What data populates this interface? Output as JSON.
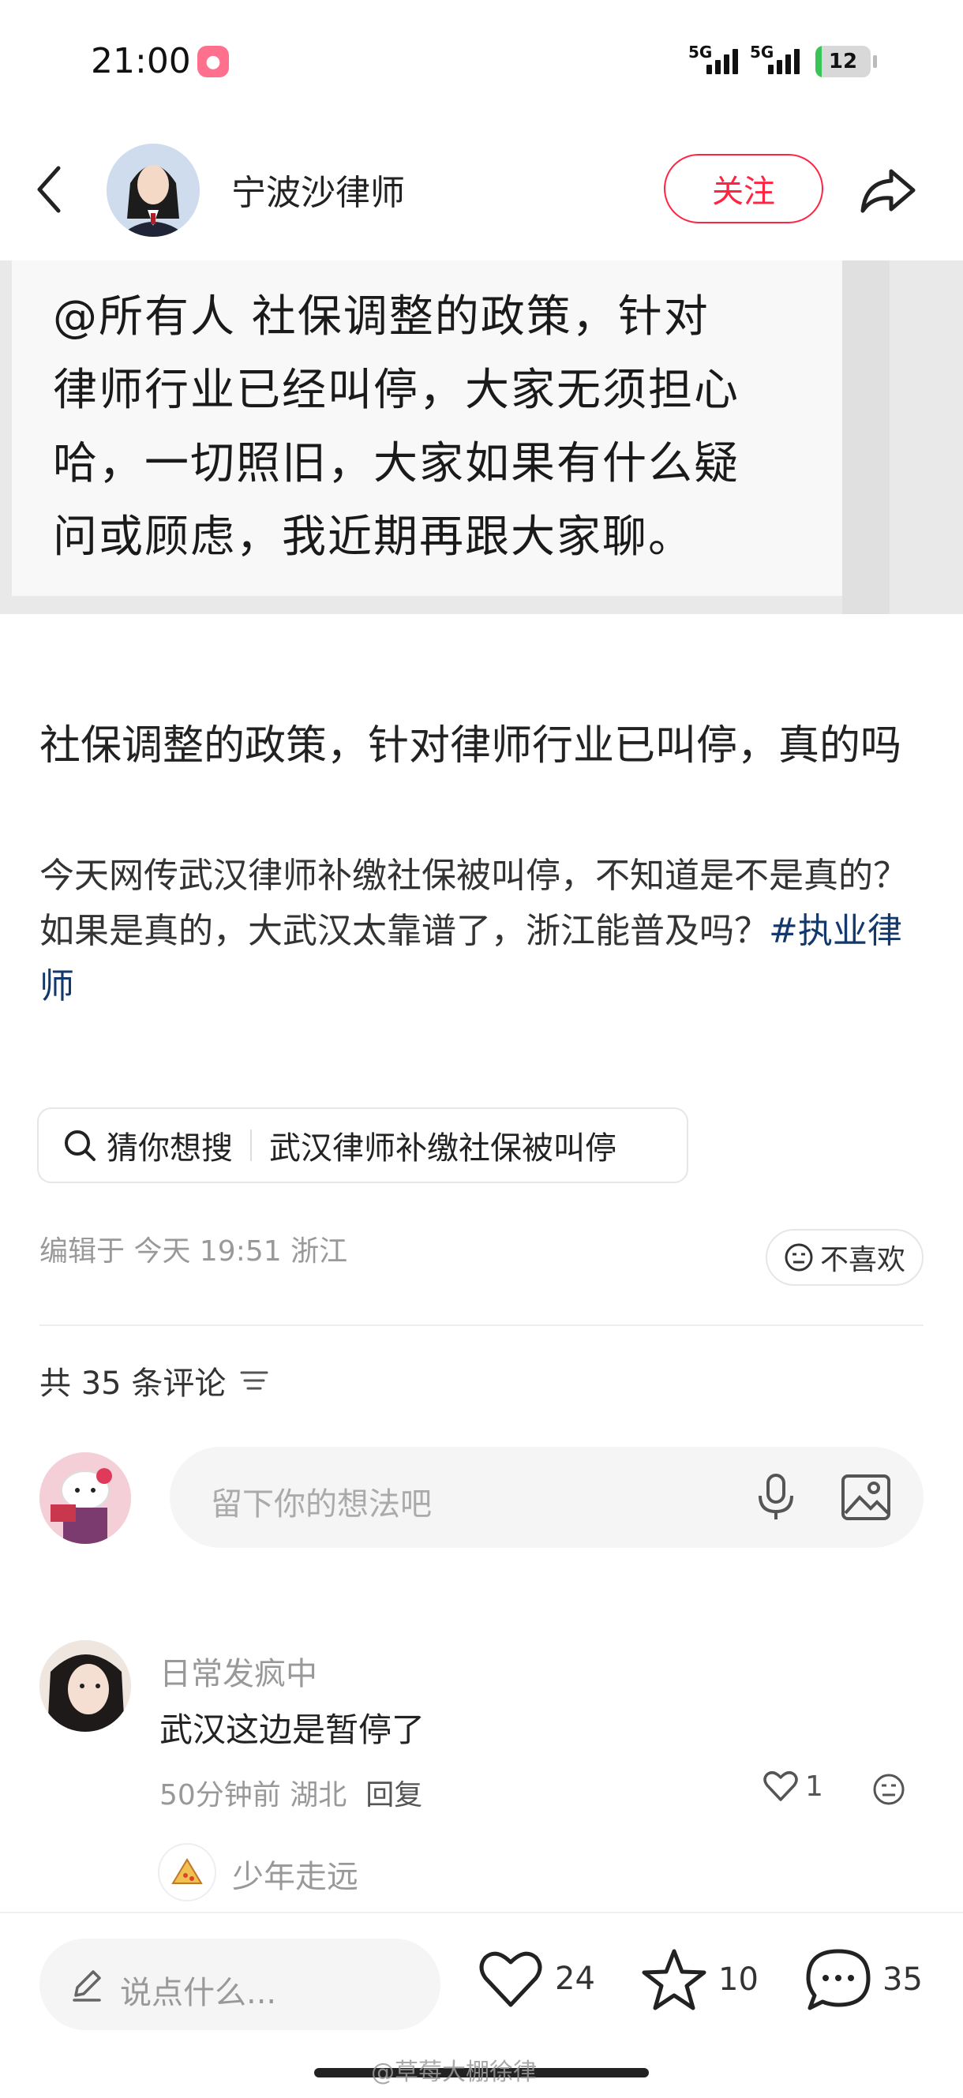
{
  "status_bar": {
    "time": "21:00",
    "network_1": "5G",
    "network_2": "5G",
    "battery": "12",
    "battery_level": 0.12
  },
  "header": {
    "author_name": "宁波沙律师",
    "follow_label": "关注"
  },
  "note_image": {
    "lines": [
      "@所有人   社保调整的政策，针对",
      "律师行业已经叫停，大家无须担心",
      "哈，一切照旧，大家如果有什么疑",
      "问或顾虑，我近期再跟大家聊。"
    ]
  },
  "post": {
    "title": "社保调整的政策，针对律师行业已叫停，真的吗",
    "body_line1": "今天网传武汉律师补缴社保被叫停，不知道是不是真的？",
    "body_line2": "如果是真的，大武汉太靠谱了，浙江能普及吗？",
    "hashtag": "#执业律师",
    "search_label": "猜你想搜",
    "search_query": "武汉律师补缴社保被叫停",
    "edited_meta": "编辑于  今天 19:51  浙江",
    "dislike_label": "不喜欢"
  },
  "comments": {
    "count_label": "共 35 条评论",
    "input_placeholder": "留下你的想法吧",
    "items": [
      {
        "name": "日常发疯中",
        "text": "武汉这边是暂停了",
        "meta": "50分钟前  湖北",
        "reply_label": "回复",
        "likes": "1"
      },
      {
        "name": "少年走远"
      }
    ]
  },
  "bottom_bar": {
    "input_placeholder": "说点什么...",
    "likes": "24",
    "collects": "10",
    "comments": "35"
  },
  "watermark": "@草莓大棚徐律",
  "colors": {
    "accent": "#ff2442",
    "hashtag": "#13386c",
    "battery": "#38c456"
  },
  "icons": [
    "back-icon",
    "share-icon",
    "search-icon",
    "filter-icon",
    "mic-icon",
    "image-icon",
    "dislike-face-icon",
    "heart-icon",
    "reaction-face-icon",
    "pen-icon",
    "star-icon",
    "comment-bubble-icon"
  ]
}
